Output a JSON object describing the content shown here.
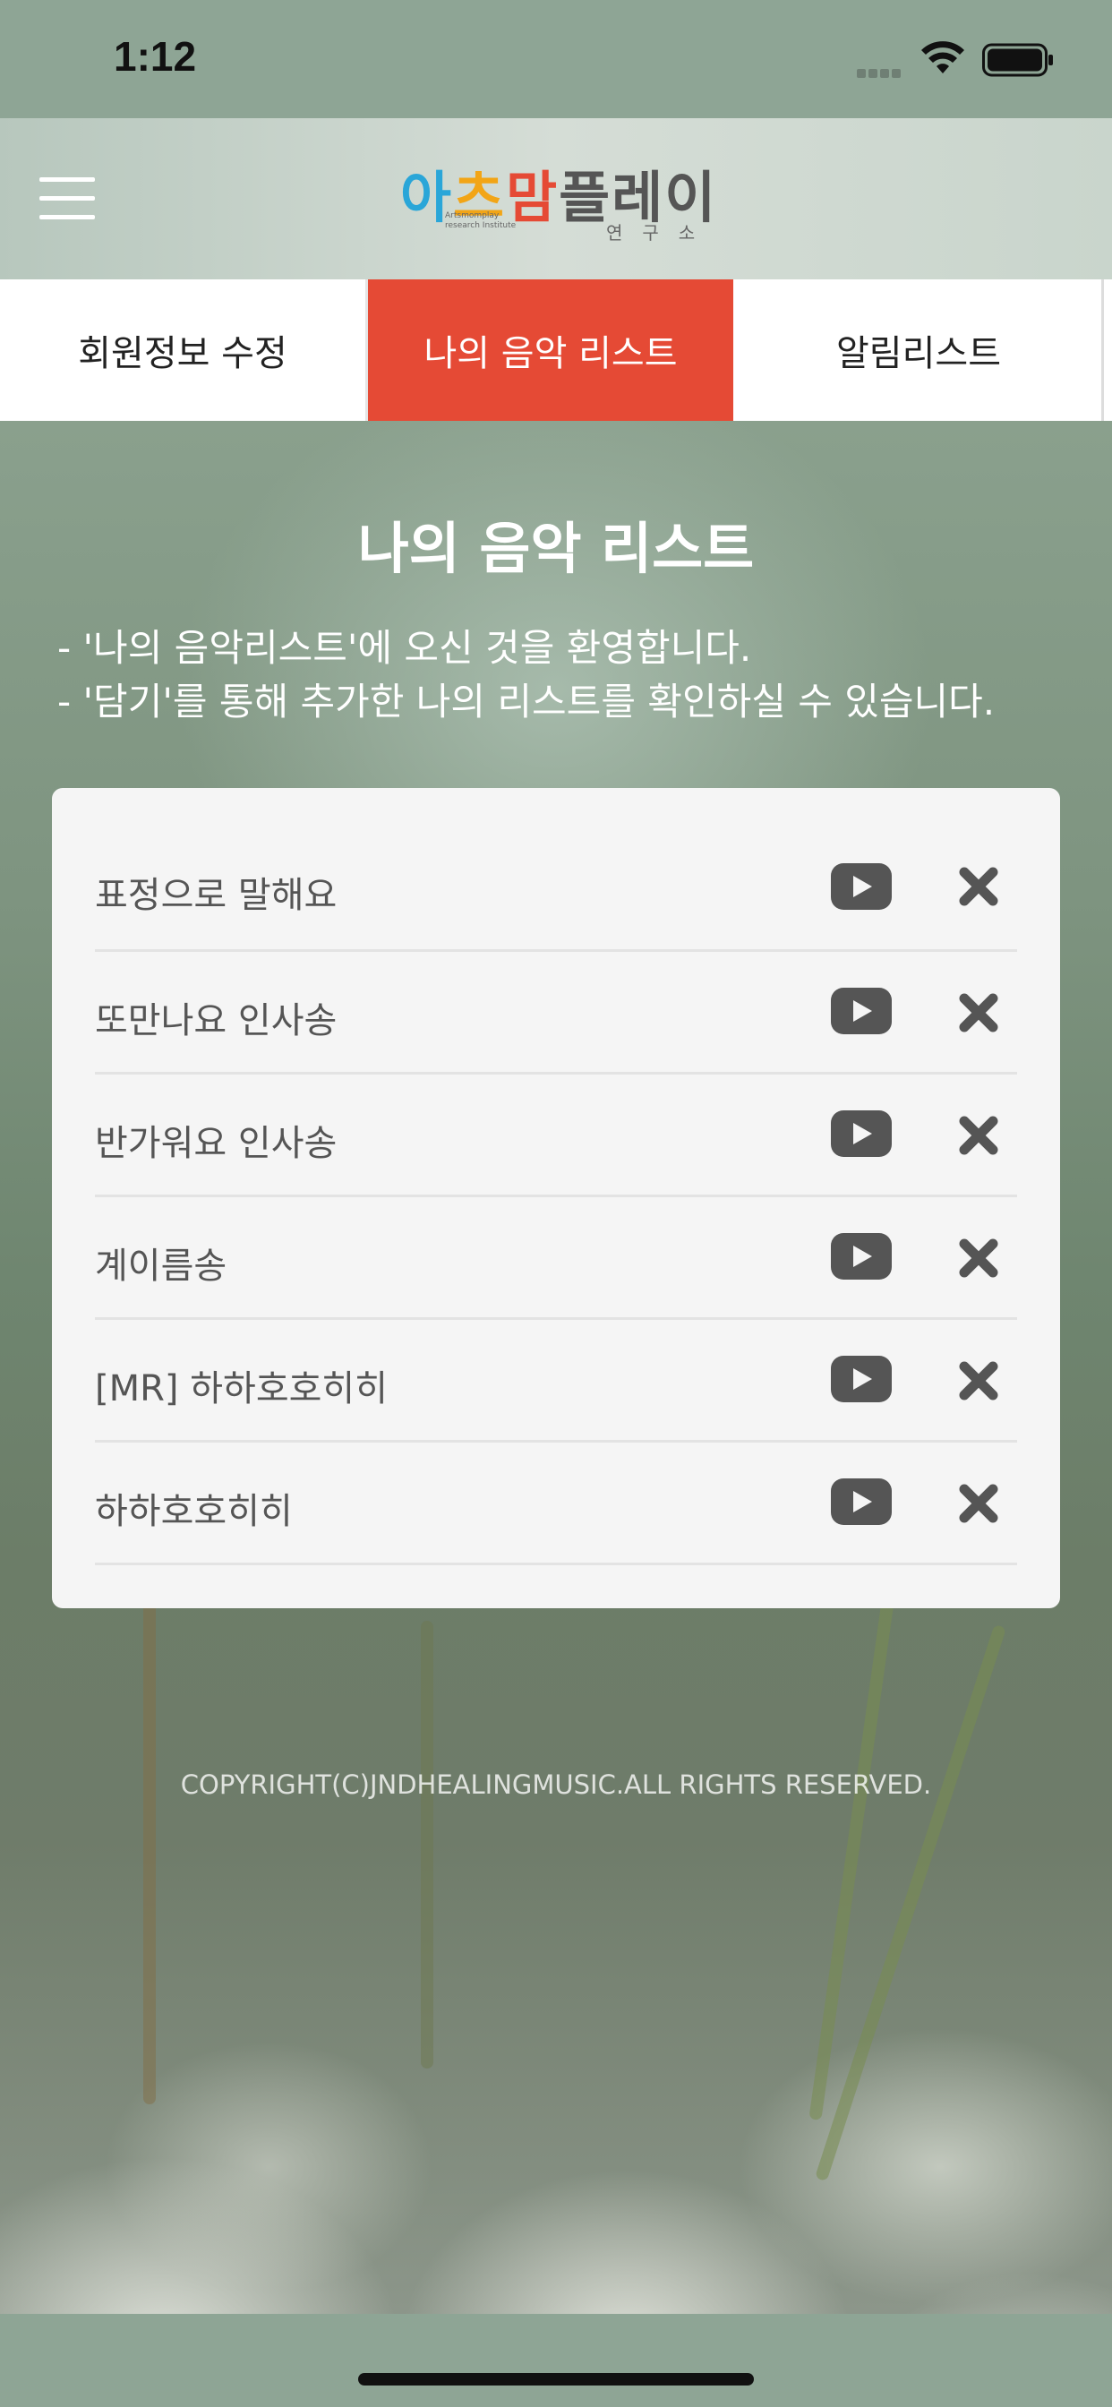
{
  "status_bar": {
    "time": "1:12"
  },
  "header": {
    "logo": {
      "text_parts": [
        "아",
        "츠",
        "맘",
        "플",
        "레",
        "이"
      ],
      "colors": [
        "#2aa6d8",
        "#f2a516",
        "#e54a35",
        "#555555",
        "#555555",
        "#555555"
      ],
      "subtitle": "Artsmomplay research Institute",
      "subtitle_korean": "연구소"
    }
  },
  "tabs": [
    {
      "label": "회원정보 수정",
      "active": false
    },
    {
      "label": "나의 음악 리스트",
      "active": true
    },
    {
      "label": "알림리스트",
      "active": false
    }
  ],
  "page": {
    "title": "나의 음악 리스트",
    "intro_lines": [
      "- '나의 음악리스트'에 오신 것을 환영합니다.",
      "- '담기'를 통해 추가한 나의 리스트를 확인하실 수 있습니다."
    ]
  },
  "music_list": [
    {
      "title": "표정으로 말해요"
    },
    {
      "title": "또만나요 인사송"
    },
    {
      "title": "반가워요 인사송"
    },
    {
      "title": "계이름송"
    },
    {
      "title": "[MR] 하하호호히히"
    },
    {
      "title": "하하호호히히"
    }
  ],
  "icons": {
    "play": "play-icon",
    "remove": "close-icon"
  },
  "footer": {
    "copyright": "COPYRIGHT(C)JNDHEALINGMUSIC.ALL RIGHTS RESERVED."
  },
  "colors": {
    "accent": "#e54a35",
    "icon_gray": "#555555"
  }
}
